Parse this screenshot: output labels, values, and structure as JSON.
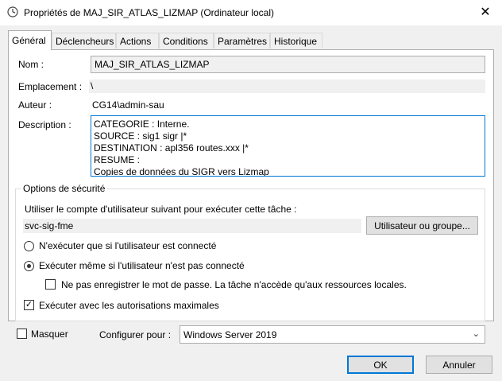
{
  "window": {
    "title": "Propriétés de MAJ_SIR_ATLAS_LIZMAP (Ordinateur local)",
    "close_glyph": "✕"
  },
  "tabs": [
    {
      "label": "Général",
      "active": true
    },
    {
      "label": "Déclencheurs",
      "active": false
    },
    {
      "label": "Actions",
      "active": false
    },
    {
      "label": "Conditions",
      "active": false
    },
    {
      "label": "Paramètres",
      "active": false
    },
    {
      "label": "Historique",
      "active": false
    }
  ],
  "general": {
    "name_label": "Nom :",
    "name_value": "MAJ_SIR_ATLAS_LIZMAP",
    "location_label": "Emplacement :",
    "location_value": "\\",
    "author_label": "Auteur :",
    "author_value": "CG14\\admin-sau",
    "description_label": "Description :",
    "description_lines": [
      "CATEGORIE : Interne.",
      "SOURCE : sig1 sigr |*",
      "DESTINATION : apl356 routes.xxx |*",
      "RESUME :",
      "Copies de données du SIGR vers Lizmap"
    ]
  },
  "security": {
    "title": "Options de sécurité",
    "account_prompt": "Utiliser le compte d'utilisateur suivant pour exécuter cette tâche :",
    "account_value": "svc-sig-fme",
    "user_group_button": "Utilisateur ou groupe...",
    "radio_logged_on": "N'exécuter que si l'utilisateur est connecté",
    "radio_whether_logged": "Exécuter même si l'utilisateur n'est pas connecté",
    "selected_radio": "whether_logged",
    "no_store_password": "Ne pas enregistrer le mot de passe. La tâche n'accède qu'aux ressources locales.",
    "no_store_password_checked": false,
    "highest_privileges": "Exécuter avec les autorisations maximales",
    "highest_privileges_checked": true
  },
  "bottom": {
    "hidden_label": "Masquer",
    "hidden_checked": false,
    "configure_label": "Configurer pour :",
    "configure_value": "Windows Server 2019",
    "ok_label": "OK",
    "cancel_label": "Annuler",
    "checkmark_glyph": "✓",
    "dropdown_glyph": "⌄"
  },
  "colors": {
    "accent": "#0078d7",
    "dialog_bg": "#f0f0f0"
  }
}
